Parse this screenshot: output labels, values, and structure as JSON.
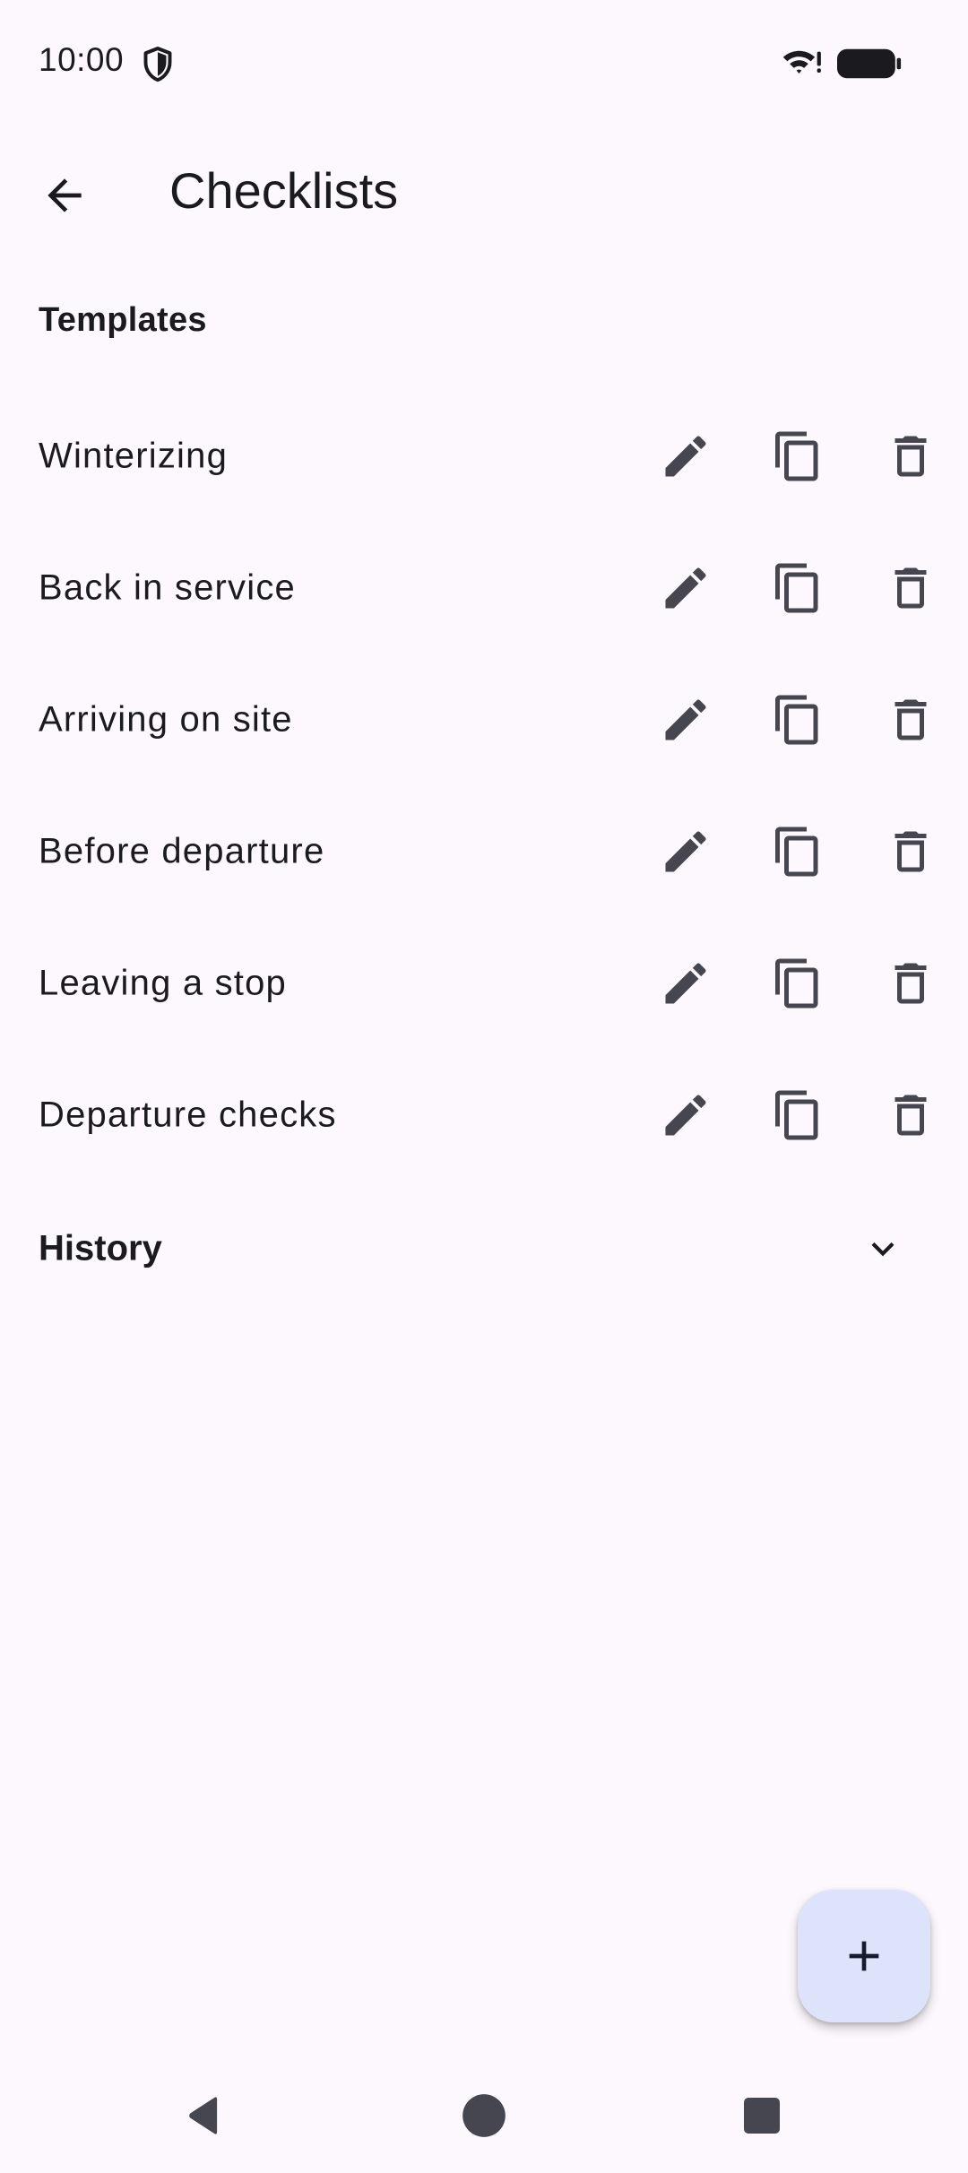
{
  "status_bar": {
    "time": "10:00",
    "icons": [
      "shield-icon",
      "wifi-icon",
      "battery-icon"
    ]
  },
  "app_bar": {
    "back_icon": "arrow-back-icon",
    "title": "Checklists"
  },
  "templates": {
    "header": "Templates",
    "items": [
      {
        "name": "Winterizing"
      },
      {
        "name": "Back in service"
      },
      {
        "name": "Arriving on site"
      },
      {
        "name": "Before departure"
      },
      {
        "name": "Leaving a stop"
      },
      {
        "name": "Departure checks"
      }
    ],
    "row_actions": [
      "edit-icon",
      "copy-icon",
      "delete-icon"
    ]
  },
  "history": {
    "label": "History",
    "icon": "chevron-down-icon"
  },
  "fab": {
    "icon": "plus-icon"
  },
  "nav_bar": {
    "icons": [
      "nav-back-icon",
      "nav-home-icon",
      "nav-recents-icon"
    ]
  },
  "colors": {
    "background": "#fcf8fd",
    "text": "#1b1b1f",
    "icon": "#45464f",
    "fab_background": "#dde3fb",
    "fab_icon": "#141b2c"
  }
}
